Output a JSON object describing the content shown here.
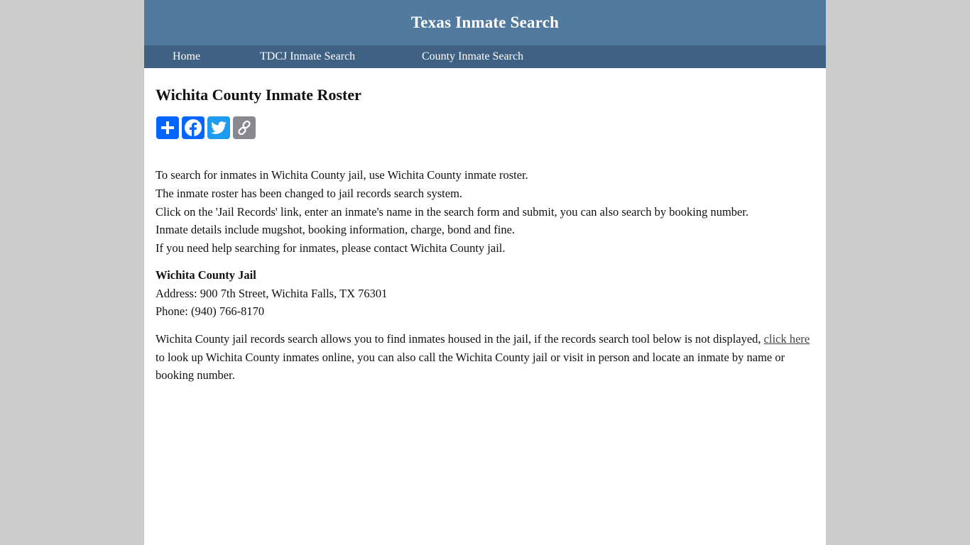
{
  "header": {
    "title": "Texas Inmate Search"
  },
  "nav": {
    "items": [
      {
        "label": "Home"
      },
      {
        "label": "TDCJ Inmate Search"
      },
      {
        "label": "County Inmate Search"
      }
    ]
  },
  "main": {
    "title": "Wichita County Inmate Roster",
    "share": {
      "buttons": [
        {
          "icon": "plus-icon",
          "color": "#0166ff"
        },
        {
          "icon": "facebook-icon",
          "color": "#0866ff"
        },
        {
          "icon": "twitter-icon",
          "color": "#1d9bf0"
        },
        {
          "icon": "link-icon",
          "color": "#888990"
        }
      ]
    },
    "intro_lines": [
      "To search for inmates in Wichita County jail, use Wichita County inmate roster.",
      "The inmate roster has been changed to jail records search system.",
      "Click on the 'Jail Records' link, enter an inmate's name in the search form and submit, you can also search by booking number.",
      "Inmate details include mugshot, booking information, charge, bond and fine.",
      "If you need help searching for inmates, please contact Wichita County jail."
    ],
    "jail": {
      "name": "Wichita County Jail",
      "address": "Address: 900 7th Street, Wichita Falls, TX 76301",
      "phone": "Phone: (940) 766-8170"
    },
    "description": {
      "before": "Wichita County jail records search allows you to find inmates housed in the jail, if the records search tool below is not displayed, ",
      "link": "click here",
      "after": " to look up Wichita County inmates online, you can also call the Wichita County jail or visit in person and locate an inmate by name or booking number."
    }
  }
}
